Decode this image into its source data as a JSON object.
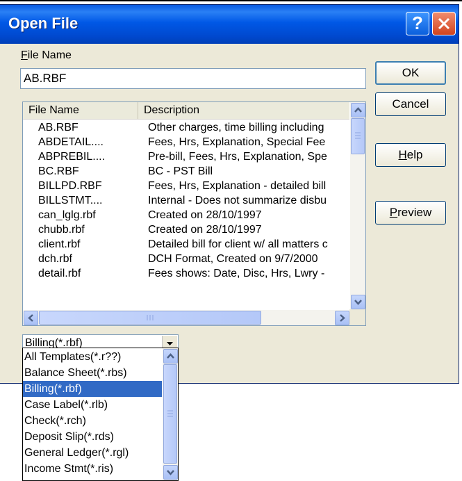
{
  "dialog": {
    "title": "Open File",
    "help_button": "?",
    "close_button": "close"
  },
  "file_name": {
    "label_accel": "F",
    "label_rest": "ile Name",
    "value": "AB.RBF"
  },
  "buttons": {
    "ok": "OK",
    "cancel": "Cancel",
    "help_accel": "H",
    "help_rest": "elp",
    "preview_accel": "P",
    "preview_rest": "review"
  },
  "list": {
    "columns": [
      "File Name",
      "Description"
    ],
    "rows": [
      {
        "name": "AB.RBF",
        "desc": "Other charges, time billing including"
      },
      {
        "name": "ABDETAIL....",
        "desc": "Fees, Hrs, Explanation, Special Fee"
      },
      {
        "name": "ABPREBIL....",
        "desc": "Pre-bill, Fees, Hrs, Explanation, Spe"
      },
      {
        "name": "BC.RBF",
        "desc": "BC - PST Bill"
      },
      {
        "name": "BILLPD.RBF",
        "desc": "Fees, Hrs, Explanation - detailed bill"
      },
      {
        "name": "BILLSTMT....",
        "desc": "Internal - Does not summarize disbu"
      },
      {
        "name": "can_lglg.rbf",
        "desc": "Created on 28/10/1997"
      },
      {
        "name": "chubb.rbf",
        "desc": "Created on 28/10/1997"
      },
      {
        "name": "client.rbf",
        "desc": "Detailed bill for client w/ all matters c"
      },
      {
        "name": "dch.rbf",
        "desc": "DCH Format, Created on 9/7/2000"
      },
      {
        "name": "detail.rbf",
        "desc": "Fees shows: Date, Disc, Hrs, Lwry -"
      }
    ]
  },
  "file_type": {
    "selected": "Billing(*.rbf)",
    "options": [
      "All Templates(*.r??)",
      "Balance Sheet(*.rbs)",
      "Billing(*.rbf)",
      "Case Label(*.rlb)",
      "Check(*.rch)",
      "Deposit Slip(*.rds)",
      "General Ledger(*.rgl)",
      "Income Stmt(*.ris)"
    ],
    "selected_index": 2
  },
  "colors": {
    "titlebar": "#0058e6",
    "dialog_bg": "#ece9d8",
    "selection": "#316ac5"
  }
}
